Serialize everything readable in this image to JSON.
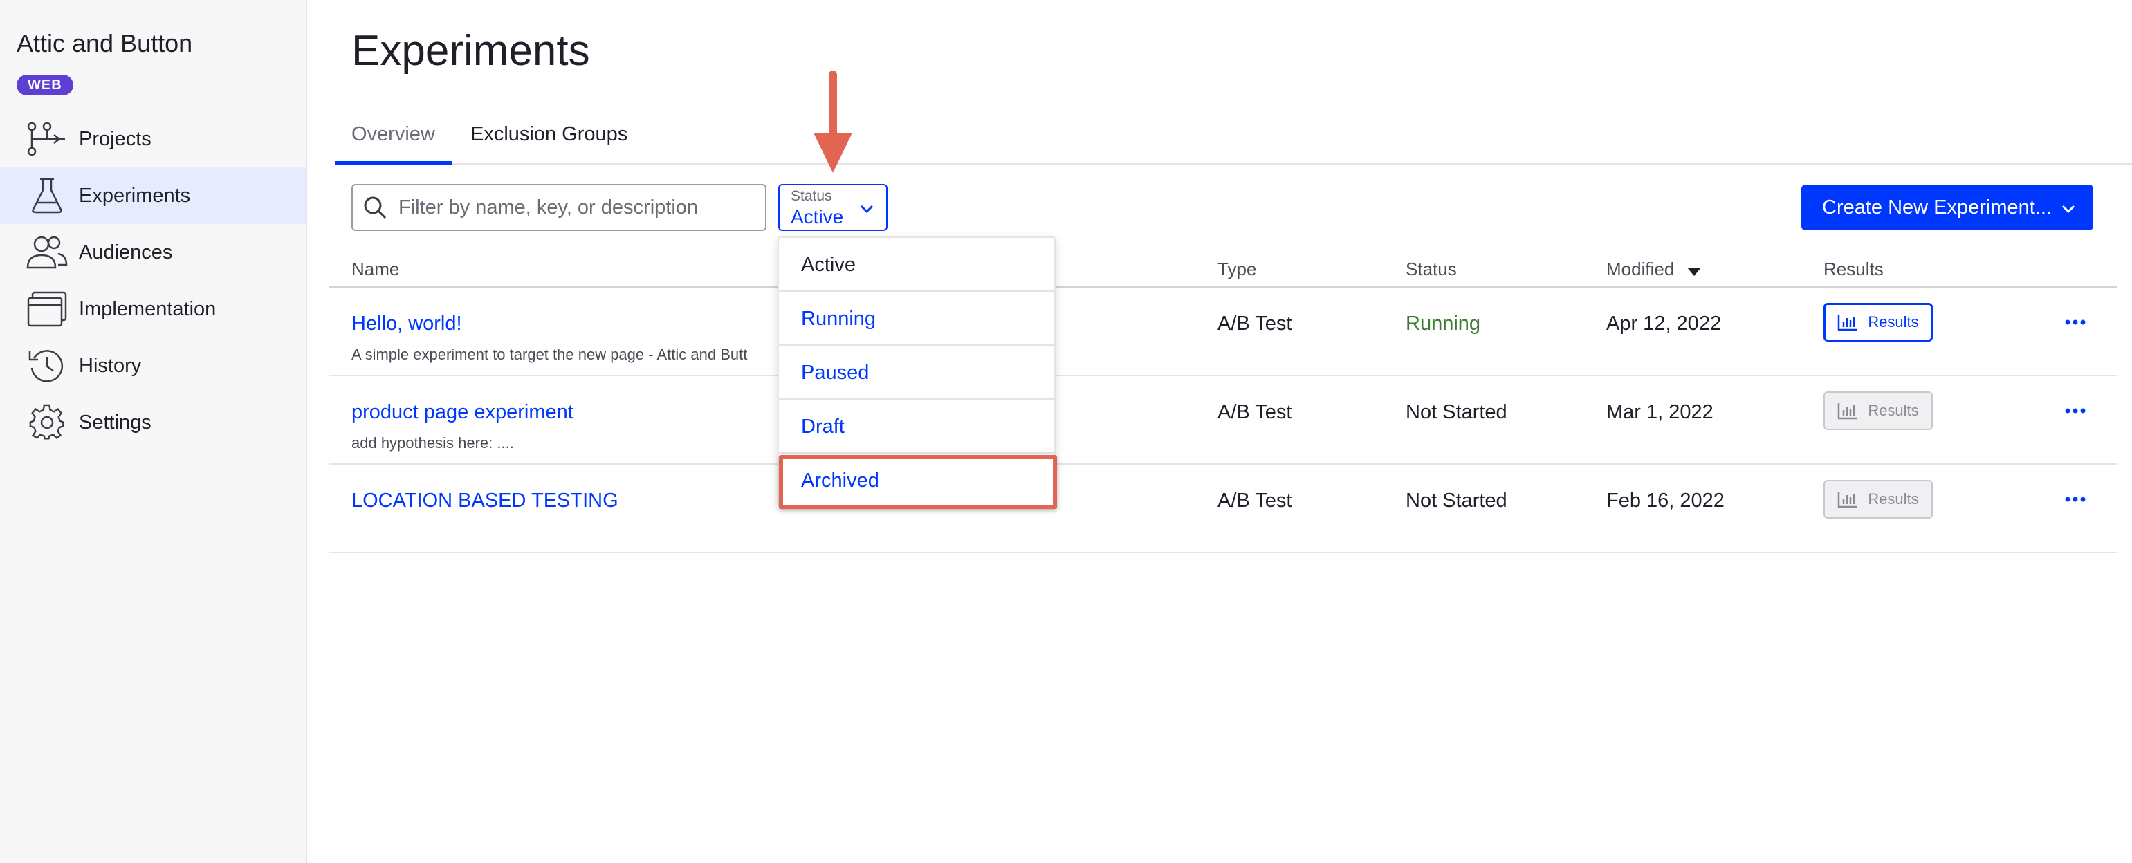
{
  "sidebar": {
    "project_name": "Attic and Button",
    "platform_badge": "WEB",
    "items": [
      {
        "label": "Projects",
        "icon": "projects-icon",
        "active": false
      },
      {
        "label": "Experiments",
        "icon": "flask-icon",
        "active": true
      },
      {
        "label": "Audiences",
        "icon": "audiences-icon",
        "active": false
      },
      {
        "label": "Implementation",
        "icon": "implementation-icon",
        "active": false
      },
      {
        "label": "History",
        "icon": "history-icon",
        "active": false
      },
      {
        "label": "Settings",
        "icon": "gear-icon",
        "active": false
      }
    ]
  },
  "main": {
    "title": "Experiments",
    "tabs": [
      {
        "label": "Overview",
        "active": true
      },
      {
        "label": "Exclusion Groups",
        "active": false
      }
    ],
    "search": {
      "placeholder": "Filter by name, key, or description",
      "value": ""
    },
    "status_filter": {
      "label": "Status",
      "value": "Active"
    },
    "create_button": "Create New Experiment...",
    "table": {
      "columns": [
        "Name",
        "Type",
        "Status",
        "Modified",
        "Results"
      ],
      "results_label": "Results",
      "rows": [
        {
          "name": "Hello, world!",
          "description": "A simple experiment to target the new page - Attic and Butt",
          "type": "A/B Test",
          "status": "Running",
          "modified": "Apr 12, 2022",
          "results_enabled": true
        },
        {
          "name": "product page experiment",
          "description": "add hypothesis here: ....",
          "type": "A/B Test",
          "status": "Not Started",
          "modified": "Mar 1, 2022",
          "results_enabled": false
        },
        {
          "name": "LOCATION BASED TESTING",
          "description": "",
          "type": "A/B Test",
          "status": "Not Started",
          "modified": "Feb 16, 2022",
          "results_enabled": false
        }
      ]
    },
    "status_dropdown": {
      "options": [
        "Active",
        "Running",
        "Paused",
        "Draft",
        "Archived"
      ],
      "selected": "Active",
      "highlighted": "Archived"
    }
  },
  "colors": {
    "accent": "#0037ff",
    "badge": "#5d3fd3",
    "running": "#3a7d2c",
    "annotation": "#e26453",
    "sidebar_active": "#e6ebfd"
  }
}
